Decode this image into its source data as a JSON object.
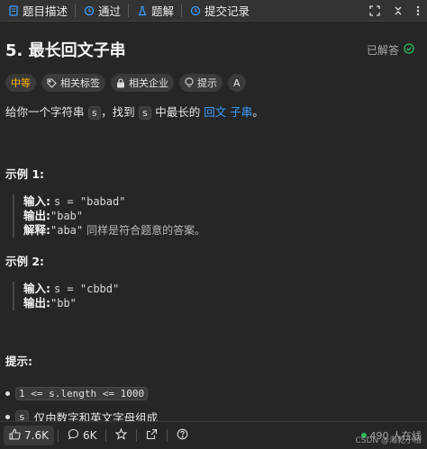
{
  "tabs": [
    {
      "label": "题目描述",
      "icon": "document-icon"
    },
    {
      "label": "通过",
      "icon": "history-icon"
    },
    {
      "label": "题解",
      "icon": "flask-icon"
    },
    {
      "label": "提交记录",
      "icon": "history-icon"
    }
  ],
  "problem": {
    "title": "5. 最长回文子串",
    "status": "已解答",
    "tags": {
      "difficulty": "中等",
      "topics": "相关标签",
      "companies": "相关企业",
      "hint": "提示",
      "font_label": "A"
    },
    "description": {
      "before": "给你一个字符串",
      "var1": "s",
      "middle": "，找到",
      "var2": "s",
      "after": "中最长的",
      "link": "回文 子串",
      "end": "。"
    }
  },
  "examples": [
    {
      "title": "示例 1:",
      "input_label": "输入:",
      "input": "s = \"babad\"",
      "output_label": "输出:",
      "output": "\"bab\"",
      "explain_label": "解释:",
      "explain_code": "\"aba\"",
      "explain_text": "同样是符合题意的答案。"
    },
    {
      "title": "示例 2:",
      "input_label": "输入:",
      "input": "s = \"cbbd\"",
      "output_label": "输出:",
      "output": "\"bb\""
    }
  ],
  "hints": {
    "title": "提示:",
    "items": [
      {
        "code": "1 <= s.length <= 1000",
        "text": ""
      },
      {
        "code": "s",
        "text": "仅由数字和英文字母组成"
      }
    ]
  },
  "footer": {
    "likes": "7.6K",
    "comments": "6K",
    "online": "490 人在线",
    "watermark": "CSDN @海乾小柏"
  },
  "colors": {
    "background": "#262626",
    "difficulty": "#ffb800",
    "link": "#3b9eff",
    "online_dot": "#2cbb5d"
  }
}
